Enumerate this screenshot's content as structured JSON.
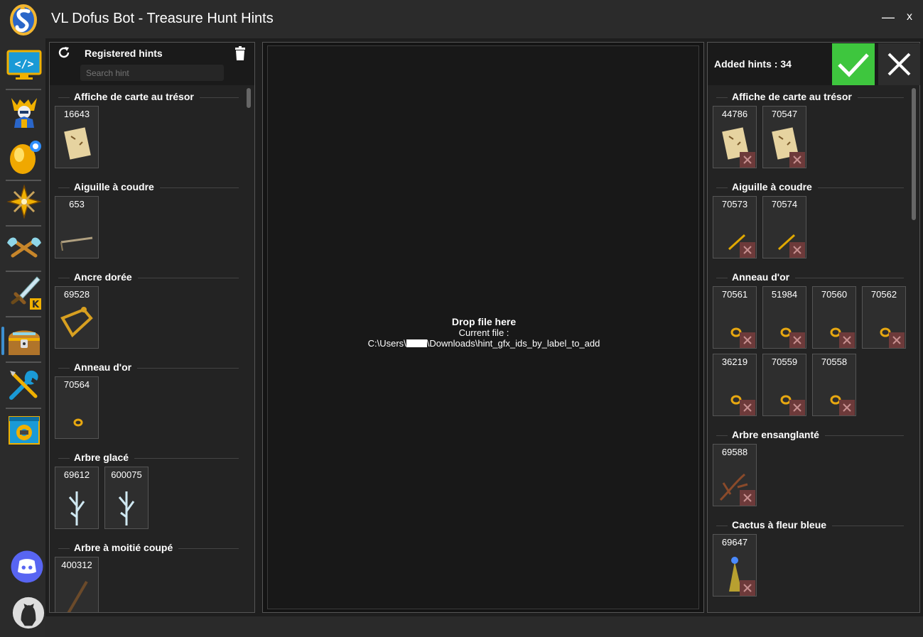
{
  "window": {
    "title": "VL Dofus Bot - Treasure Hunt Hints",
    "minimize_label": "—",
    "close_label": "x"
  },
  "sidebar": {
    "items": [
      {
        "name": "scripts-icon"
      },
      {
        "name": "character-icon"
      },
      {
        "name": "dofus-egg-icon"
      },
      {
        "name": "compass-star-icon"
      },
      {
        "name": "axes-icon"
      },
      {
        "name": "sword-icon"
      },
      {
        "name": "treasure-chest-icon"
      },
      {
        "name": "tools-icon"
      },
      {
        "name": "settings-window-icon"
      },
      {
        "name": "discord-icon"
      },
      {
        "name": "github-icon"
      }
    ],
    "active": "treasure-chest-icon"
  },
  "left_panel": {
    "title": "Registered hints",
    "search_placeholder": "Search hint",
    "groups": [
      {
        "label": "Affiche de carte au trésor",
        "items": [
          "16643"
        ]
      },
      {
        "label": "Aiguille à coudre",
        "items": [
          "653"
        ]
      },
      {
        "label": "Ancre dorée",
        "items": [
          "69528"
        ]
      },
      {
        "label": "Anneau d'or",
        "items": [
          "70564"
        ]
      },
      {
        "label": "Arbre glacé",
        "items": [
          "69612",
          "600075"
        ]
      },
      {
        "label": "Arbre à moitié coupé",
        "items": [
          "400312"
        ]
      }
    ]
  },
  "drop_zone": {
    "title": "Drop file here",
    "current_label": "Current file :",
    "path_prefix": "C:\\Users\\",
    "path_suffix": "\\Downloads\\hint_gfx_ids_by_label_to_add"
  },
  "right_panel": {
    "added_label": "Added hints : 34",
    "groups": [
      {
        "label": "Affiche de carte au trésor",
        "items": [
          "44786",
          "70547"
        ]
      },
      {
        "label": "Aiguille à coudre",
        "items": [
          "70573",
          "70574"
        ]
      },
      {
        "label": "Anneau d'or",
        "items": [
          "70561",
          "51984",
          "70560",
          "70562",
          "36219",
          "70559",
          "70558"
        ]
      },
      {
        "label": "Arbre ensanglanté",
        "items": [
          "69588"
        ]
      },
      {
        "label": "Cactus à fleur bleue",
        "items": [
          "69647"
        ]
      }
    ]
  },
  "colors": {
    "confirm": "#3ec63e",
    "remove": "#6d3a3a",
    "accent": "#3d8fd0"
  }
}
